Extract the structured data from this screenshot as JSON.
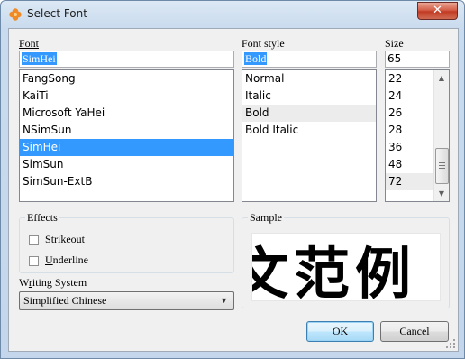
{
  "window": {
    "title": "Select Font",
    "close_glyph": "✕"
  },
  "font_section": {
    "label": "Font",
    "value": "SimHei",
    "items": [
      {
        "label": "FangSong"
      },
      {
        "label": "KaiTi"
      },
      {
        "label": "Microsoft YaHei"
      },
      {
        "label": "NSimSun"
      },
      {
        "label": "SimHei",
        "selected": true
      },
      {
        "label": "SimSun"
      },
      {
        "label": "SimSun-ExtB"
      }
    ]
  },
  "style_section": {
    "label": "Font style",
    "value": "Bold",
    "items": [
      {
        "label": "Normal"
      },
      {
        "label": "Italic"
      },
      {
        "label": "Bold",
        "highlight": true
      },
      {
        "label": "Bold Italic"
      }
    ]
  },
  "size_section": {
    "label": "Size",
    "value": "65",
    "items": [
      {
        "label": "22"
      },
      {
        "label": "24"
      },
      {
        "label": "26"
      },
      {
        "label": "28"
      },
      {
        "label": "36"
      },
      {
        "label": "48"
      },
      {
        "label": "72",
        "highlight": true
      }
    ]
  },
  "effects": {
    "label": "Effects",
    "strikeout_label": "Strikeout",
    "underline_label": "Underline",
    "strikeout_checked": false,
    "underline_checked": false
  },
  "writing_system": {
    "label": "Writing System",
    "value": "Simplified Chinese"
  },
  "sample": {
    "label": "Sample",
    "text": "文范例"
  },
  "buttons": {
    "ok": "OK",
    "cancel": "Cancel"
  },
  "colors": {
    "selection": "#3399ff",
    "close_button": "#c13b23",
    "app_icon": "#f08a24"
  },
  "icons": {
    "app": "clover-app-icon",
    "close": "close-icon",
    "scroll_up": "scroll-up-arrow-icon",
    "scroll_down": "scroll-down-arrow-icon",
    "dropdown": "chevron-down-icon",
    "resize": "resize-grip-icon"
  }
}
